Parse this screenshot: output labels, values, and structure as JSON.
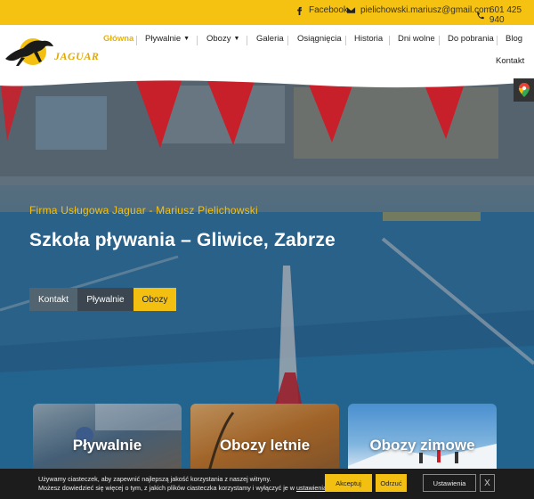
{
  "topbar": {
    "facebook_label": "Facebook",
    "email": "pielichowski.mariusz@gmail.com",
    "phone": "601 425 940"
  },
  "brand": {
    "logo_text": "JAGUAR"
  },
  "nav": {
    "items": [
      {
        "label": "Główna",
        "active": true
      },
      {
        "label": "Pływalnie",
        "dropdown": true
      },
      {
        "label": "Obozy",
        "dropdown": true
      },
      {
        "label": "Galeria"
      },
      {
        "label": "Osiągnięcia"
      },
      {
        "label": "Historia"
      },
      {
        "label": "Dni wolne"
      },
      {
        "label": "Do pobrania"
      },
      {
        "label": "Blog"
      },
      {
        "label": "Kontakt"
      }
    ]
  },
  "hero": {
    "subtitle": "Firma Usługowa Jaguar - Mariusz Pielichowski",
    "title": "Szkoła pływania – Gliwice, Zabrze",
    "buttons": [
      "Kontakt",
      "Pływalnie",
      "Obozy"
    ]
  },
  "cards": [
    {
      "title": "Pływalnie"
    },
    {
      "title": "Obozy letnie"
    },
    {
      "title": "Obozy zimowe"
    }
  ],
  "cookie": {
    "line1": "Używamy ciasteczek, aby zapewnić najlepszą jakość korzystania z naszej witryny.",
    "line2_prefix": "Możesz dowiedzieć się więcej o tym, z jakich plików ciasteczka korzystamy i wyłączyć je w ",
    "link": "ustawieniach",
    "line2_suffix": ".",
    "accept": "Akceptuj",
    "reject": "Odrzuć",
    "settings": "Ustawienia",
    "close": "X"
  },
  "colors": {
    "brand_yellow": "#f3c011",
    "topbar_yellow": "#f6c211",
    "dark": "#1c1c1c",
    "pool_blue": "#2a6fa3",
    "flag_red": "#c8202a"
  },
  "icons": {
    "facebook": "facebook-icon",
    "email": "envelope-icon",
    "phone": "phone-icon",
    "map": "google-maps-icon"
  }
}
